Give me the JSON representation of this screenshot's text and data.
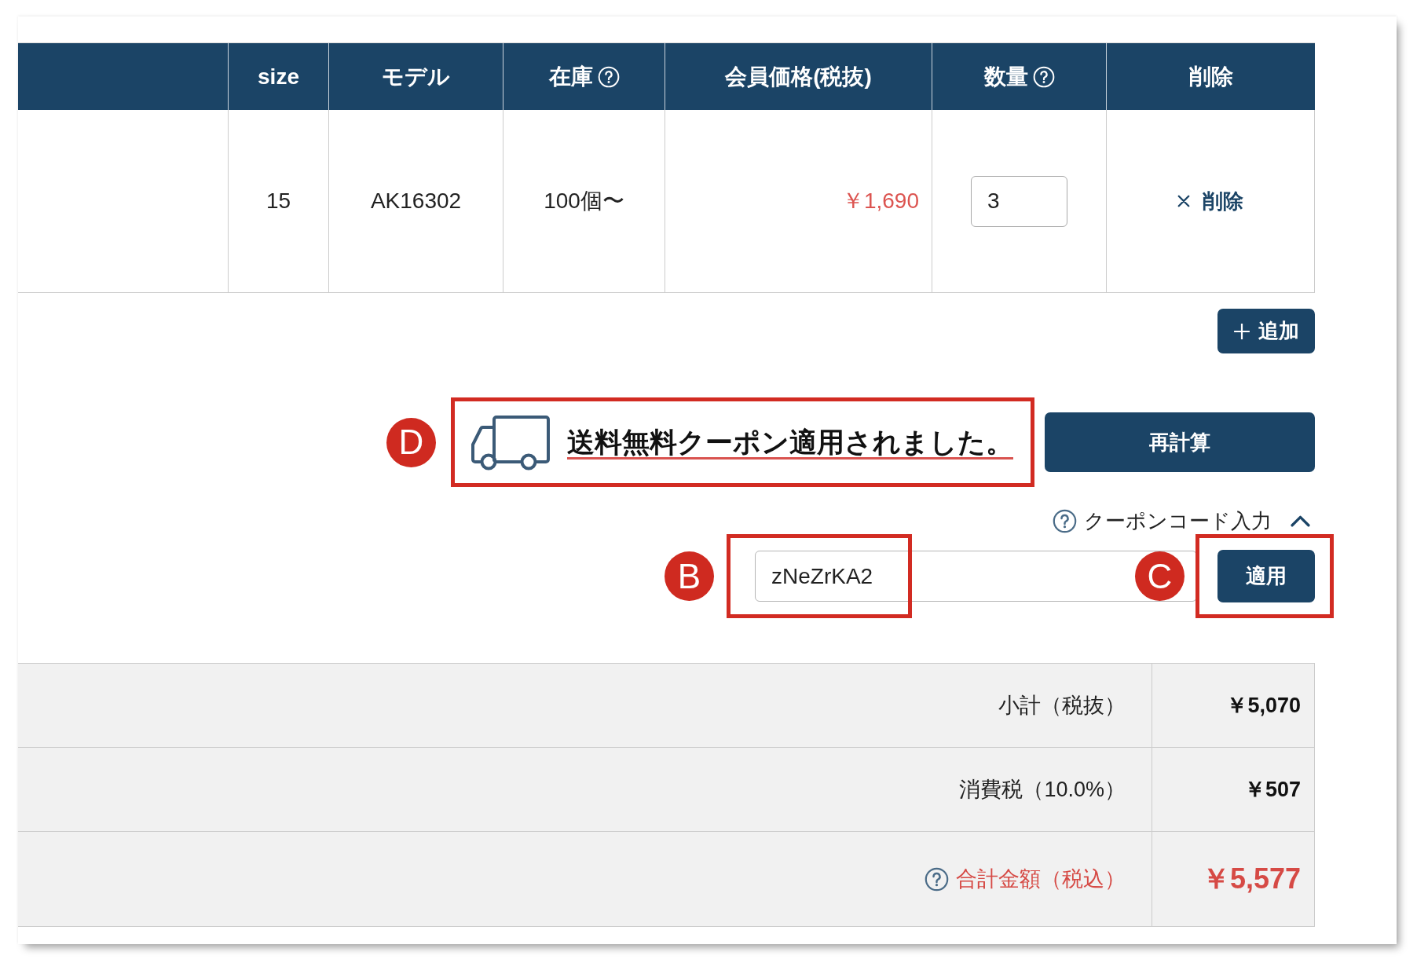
{
  "table": {
    "columns": [
      {
        "label": "size",
        "help": false
      },
      {
        "label": "モデル",
        "help": false
      },
      {
        "label": "在庫",
        "help": true
      },
      {
        "label": "会員価格(税抜)",
        "help": false
      },
      {
        "label": "数量",
        "help": true
      },
      {
        "label": "削除",
        "help": false
      }
    ],
    "rows": [
      {
        "size": "15",
        "model": "AK16302",
        "stock": "100個〜",
        "price": "￥1,690",
        "quantity": "3",
        "delete": "削除"
      }
    ]
  },
  "add_button": "追加",
  "notice": {
    "text": "送料無料クーポン適用されました。",
    "annotation": "D"
  },
  "recalculate_button": "再計算",
  "coupon": {
    "toggle_label": "クーポンコード入力",
    "expanded": true,
    "value": "zNeZrKA2",
    "input_annotation": "B",
    "apply_button": "適用",
    "apply_annotation": "C"
  },
  "totals": [
    {
      "kind": "line",
      "label": "小計（税抜）",
      "value": "￥5,070",
      "help": false
    },
    {
      "kind": "line",
      "label": "消費税（10.0%）",
      "value": "￥507",
      "help": false
    },
    {
      "kind": "total",
      "label": "合計金額（税込）",
      "value": "￥5,577",
      "help": true
    }
  ]
}
